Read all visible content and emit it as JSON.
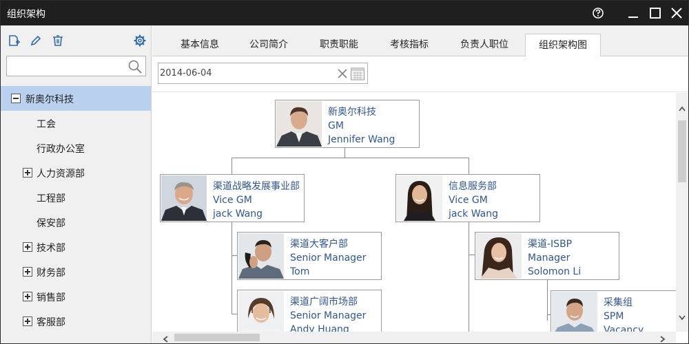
{
  "window": {
    "title": "组织架构"
  },
  "sidebar": {
    "search": {
      "value": "",
      "placeholder": ""
    },
    "toolbar": [
      "add-icon",
      "edit-icon",
      "delete-icon",
      "settings-icon"
    ],
    "tree": [
      {
        "label": "新奥尔科技",
        "expander": "minus",
        "selected": true,
        "indent": 0
      },
      {
        "label": "工会",
        "expander": "none",
        "selected": false,
        "indent": 1
      },
      {
        "label": "行政办公室",
        "expander": "none",
        "selected": false,
        "indent": 1
      },
      {
        "label": "人力资源部",
        "expander": "plus",
        "selected": false,
        "indent": 1
      },
      {
        "label": "工程部",
        "expander": "none",
        "selected": false,
        "indent": 1
      },
      {
        "label": "保安部",
        "expander": "none",
        "selected": false,
        "indent": 1
      },
      {
        "label": "技术部",
        "expander": "plus",
        "selected": false,
        "indent": 1
      },
      {
        "label": "财务部",
        "expander": "plus",
        "selected": false,
        "indent": 1
      },
      {
        "label": "销售部",
        "expander": "plus",
        "selected": false,
        "indent": 1
      },
      {
        "label": "客服部",
        "expander": "plus",
        "selected": false,
        "indent": 1
      }
    ]
  },
  "tabs": [
    {
      "label": "基本信息",
      "active": false
    },
    {
      "label": "公司简介",
      "active": false
    },
    {
      "label": "职责职能",
      "active": false
    },
    {
      "label": "考核指标",
      "active": false
    },
    {
      "label": "负责人职位",
      "active": false
    },
    {
      "label": "组织架构图",
      "active": true
    }
  ],
  "date_filter": {
    "value": "2014-06-04"
  },
  "org_chart": {
    "nodes": [
      {
        "dept": "新奥尔科技",
        "title": "GM",
        "name": "Jennifer Wang",
        "photo": "man-in-suit"
      },
      {
        "dept": "渠道战略发展事业部",
        "title": "Vice GM",
        "name": "jack Wang",
        "photo": "older-man"
      },
      {
        "dept": "信息服务部",
        "title": "Vice GM",
        "name": "jack  Wang",
        "photo": "woman-long-hair"
      },
      {
        "dept": "渠道大客户部",
        "title": "Senior Manager",
        "name": "Tom",
        "photo": "man-on-phone"
      },
      {
        "dept": "渠道-ISBP",
        "title": "Manager",
        "name": "Solomon Li",
        "photo": "woman-smiling"
      },
      {
        "dept": "渠道广阔市场部",
        "title": "Senior Manager",
        "name": "Andy Huang",
        "photo": "woman-headset"
      },
      {
        "dept": "采集组",
        "title": "SPM",
        "name": "Vacancy",
        "photo": "young-man"
      }
    ]
  },
  "colors": {
    "titlebar": "#1f1f1f",
    "selected": "#b9d1ee",
    "link": "#2f5696",
    "icon": "#2f6ab0"
  }
}
